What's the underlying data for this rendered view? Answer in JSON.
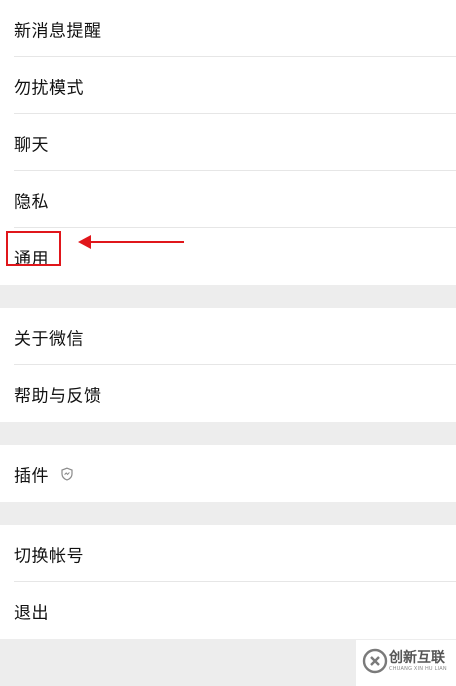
{
  "settings": {
    "group1": [
      {
        "label": "新消息提醒"
      },
      {
        "label": "勿扰模式"
      },
      {
        "label": "聊天"
      },
      {
        "label": "隐私"
      },
      {
        "label": "通用"
      }
    ],
    "group2": [
      {
        "label": "关于微信"
      },
      {
        "label": "帮助与反馈"
      }
    ],
    "group3": [
      {
        "label": "插件",
        "icon": "shield-icon"
      }
    ],
    "group4": [
      {
        "label": "切换帐号"
      },
      {
        "label": "退出"
      }
    ]
  },
  "annotation": {
    "highlight_color": "#e0161b"
  },
  "watermark": {
    "name": "创新互联",
    "subtitle": "CHUANG XIN HU LIAN"
  }
}
